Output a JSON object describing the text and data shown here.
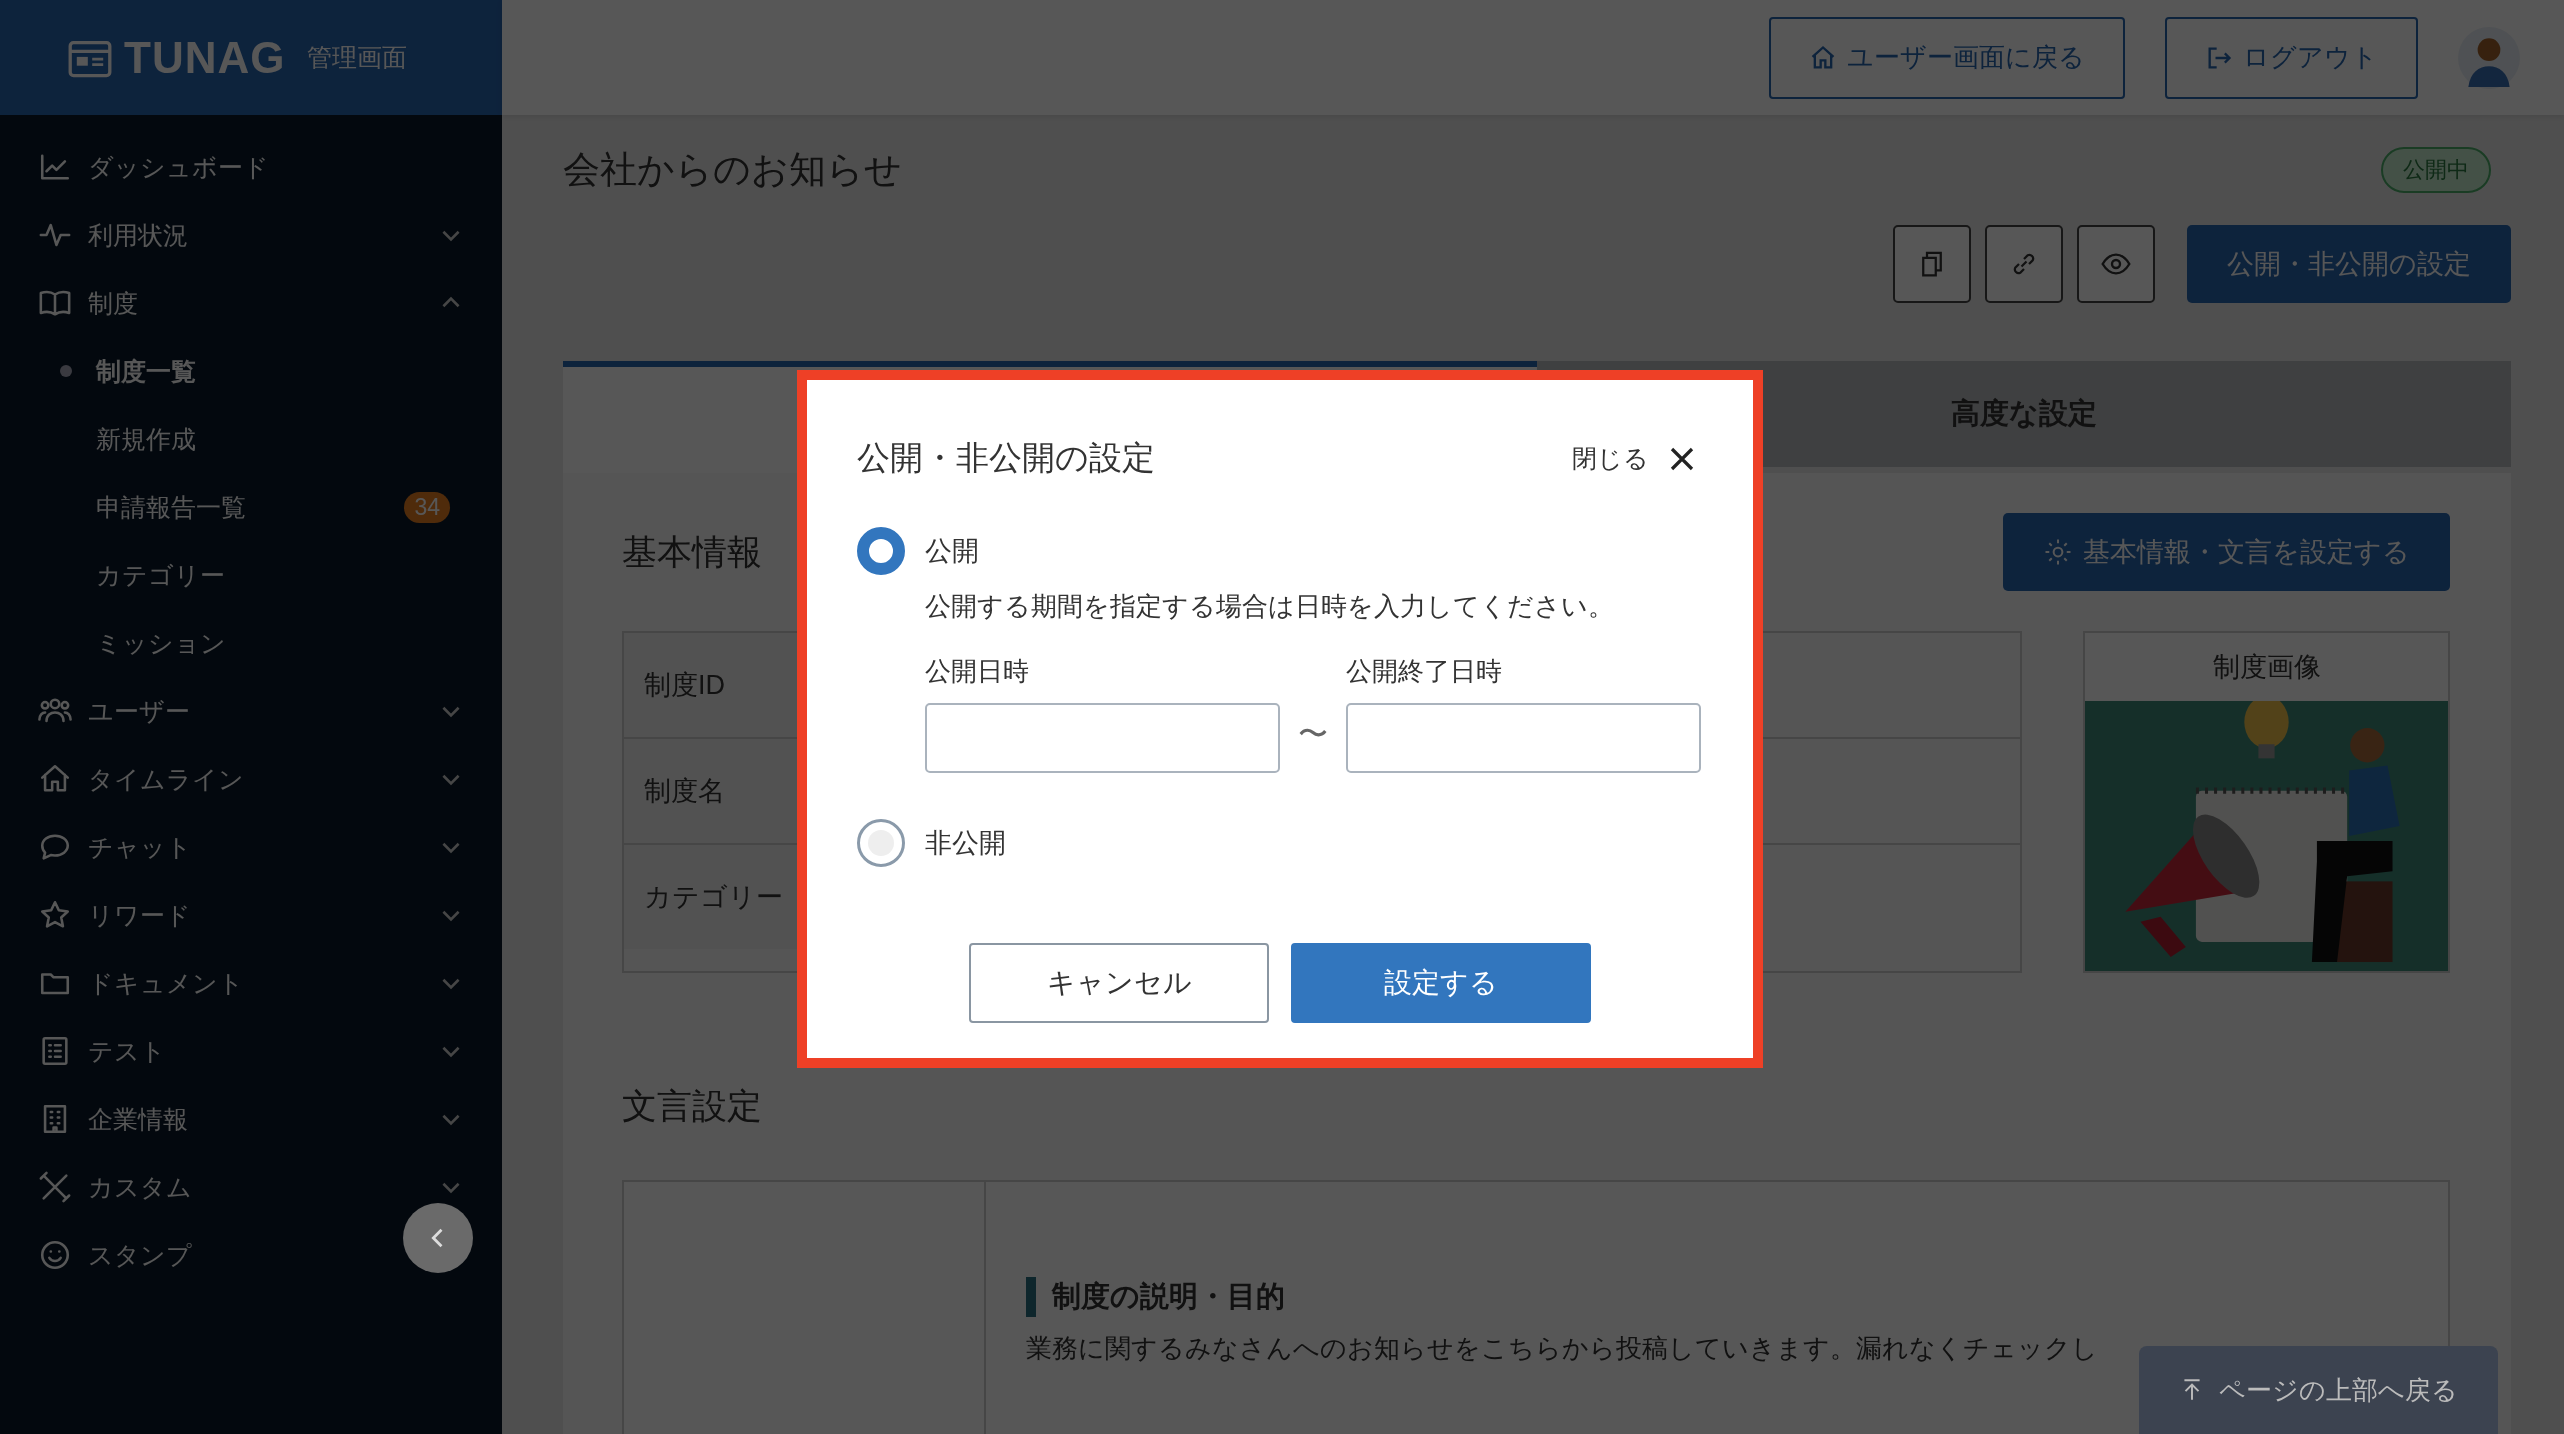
{
  "sidebar": {
    "logo": "TUNAG",
    "subtitle": "管理画面",
    "items": [
      {
        "label": "ダッシュボード",
        "kind": "link"
      },
      {
        "label": "利用状況",
        "kind": "group",
        "expanded": false
      },
      {
        "label": "制度",
        "kind": "group",
        "expanded": true,
        "children": [
          {
            "label": "制度一覧",
            "selected": true
          },
          {
            "label": "新規作成",
            "selected": false
          },
          {
            "label": "申請報告一覧",
            "selected": false,
            "badge": "34"
          },
          {
            "label": "カテゴリー",
            "selected": false
          },
          {
            "label": "ミッション",
            "selected": false
          }
        ]
      },
      {
        "label": "ユーザー",
        "kind": "group",
        "expanded": false
      },
      {
        "label": "タイムライン",
        "kind": "group",
        "expanded": false
      },
      {
        "label": "チャット",
        "kind": "group",
        "expanded": false
      },
      {
        "label": "リワード",
        "kind": "group",
        "expanded": false
      },
      {
        "label": "ドキュメント",
        "kind": "group",
        "expanded": false
      },
      {
        "label": "テスト",
        "kind": "group",
        "expanded": false
      },
      {
        "label": "企業情報",
        "kind": "group",
        "expanded": false
      },
      {
        "label": "カスタム",
        "kind": "group",
        "expanded": false
      },
      {
        "label": "スタンプ",
        "kind": "link"
      }
    ]
  },
  "header": {
    "buttons": [
      "ユーザー画面に戻る",
      "ログアウト"
    ]
  },
  "page": {
    "title": "会社からのお知らせ",
    "status_badge": "公開中",
    "toolbar_button": "公開・非公開の設定",
    "tabs": [
      {
        "selected": true
      },
      {
        "label": "高度な設定",
        "selected": false
      }
    ],
    "basic_info": {
      "heading": "基本情報",
      "button": "基本情報・文言を設定する",
      "rows": [
        {
          "label": "制度ID"
        },
        {
          "label": "制度名"
        },
        {
          "label": "カテゴリー"
        }
      ],
      "image_card": {
        "title": "制度画像",
        "kind": "picture"
      }
    },
    "wording": {
      "heading": "文言設定",
      "section_title": "制度の説明・目的",
      "body": "業務に関するみなさんへのお知らせをこちらから投稿していきます。漏れなくチェックし"
    },
    "back_to_top": "ページの上部へ戻る"
  },
  "modal": {
    "title": "公開・非公開の設定",
    "close_label": "閉じる",
    "options": [
      {
        "label": "公開",
        "selected": true,
        "hint": "公開する期間を指定する場合は日時を入力してください。"
      },
      {
        "label": "非公開",
        "selected": false
      }
    ],
    "fields": [
      {
        "label": "公開日時"
      },
      {
        "label": "公開終了日時"
      }
    ],
    "separator": "〜",
    "buttons": [
      {
        "label": "キャンセル",
        "kind": "secondary"
      },
      {
        "label": "設定する",
        "kind": "primary"
      }
    ]
  }
}
